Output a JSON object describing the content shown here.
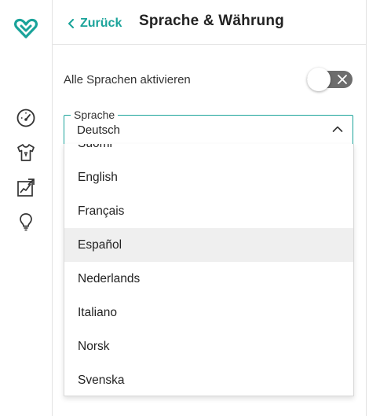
{
  "header": {
    "back_label": "Zurück",
    "title": "Sprache & Währung"
  },
  "settings": {
    "all_languages_label": "Alle Sprachen aktivieren",
    "all_languages_enabled": false
  },
  "language_select": {
    "legend": "Sprache",
    "value": "Deutsch",
    "expanded": true,
    "options": [
      "Suomi",
      "English",
      "Français",
      "Español",
      "Nederlands",
      "Italiano",
      "Norsk",
      "Svenska"
    ],
    "highlighted": "Español"
  },
  "colors": {
    "accent": "#1aa39a",
    "toggle_track": "#6d6d6d",
    "hover_bg": "#efefef"
  },
  "icons": [
    "heart-logo-icon",
    "speedometer-icon",
    "tshirt-icon",
    "image-chart-icon",
    "lightbulb-icon",
    "chevron-left-icon",
    "close-icon",
    "chevron-up-icon"
  ]
}
